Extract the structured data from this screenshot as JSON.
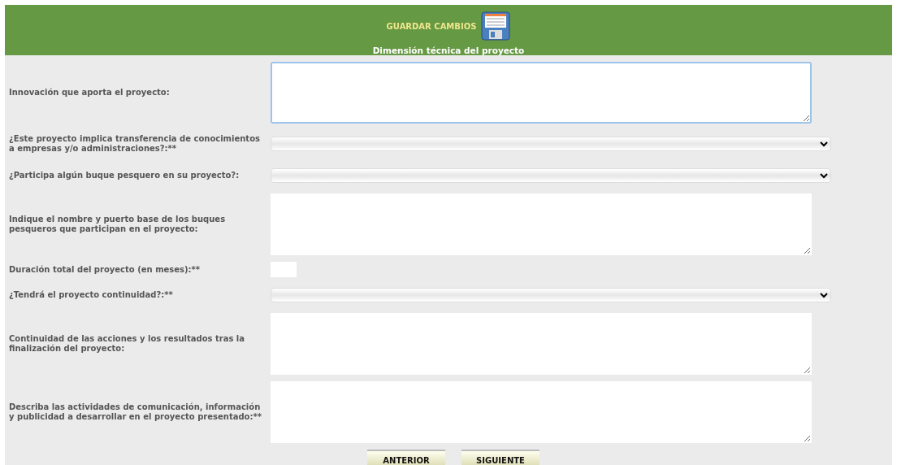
{
  "header": {
    "save_label": "GUARDAR CAMBIOS",
    "section_title": "Dimensión técnica del proyecto"
  },
  "fields": [
    {
      "kind": "textarea",
      "label": "Innovación que aporta el proyecto:",
      "focused": true
    },
    {
      "kind": "select",
      "label": "¿Este proyecto implica transferencia de conocimientos a empresas y/o administraciones?:**"
    },
    {
      "kind": "select",
      "label": "¿Participa algún buque pesquero en su proyecto?:"
    },
    {
      "kind": "textarea",
      "label": "Indique el nombre y puerto base de los buques pesqueros que participan en el proyecto:",
      "focused": false
    },
    {
      "kind": "number",
      "label": "Duración total del proyecto (en meses):**"
    },
    {
      "kind": "select",
      "label": "¿Tendrá el proyecto continuidad?:**"
    },
    {
      "kind": "textarea",
      "label": "Continuidad de las acciones y los resultados tras la finalización del proyecto:",
      "focused": false
    },
    {
      "kind": "textarea",
      "label": "Describa las actividades de comunicación, información y publicidad a desarrollar en el proyecto presentado:**",
      "focused": false
    }
  ],
  "buttons": [
    "ANTERIOR",
    "SIGUIENTE"
  ]
}
